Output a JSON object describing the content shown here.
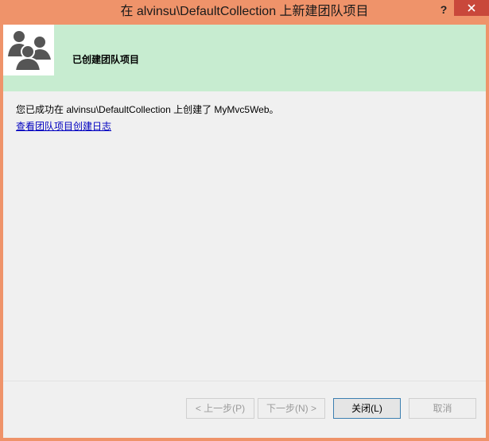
{
  "window": {
    "title": "在 alvinsu\\DefaultCollection 上新建团队项目",
    "help_label": "?"
  },
  "banner": {
    "title": "已创建团队项目",
    "icon": "team-people-icon"
  },
  "content": {
    "message": "您已成功在 alvinsu\\DefaultCollection 上创建了 MyMvc5Web。",
    "log_link": "查看团队项目创建日志"
  },
  "buttons": {
    "prev": "< 上一步(P)",
    "next": "下一步(N) >",
    "close": "关闭(L)",
    "cancel": "取消"
  },
  "colors": {
    "titlebar": "#ef936a",
    "banner": "#c7ecd0",
    "close_window_button": "#c9483b",
    "link": "#0000c0"
  }
}
